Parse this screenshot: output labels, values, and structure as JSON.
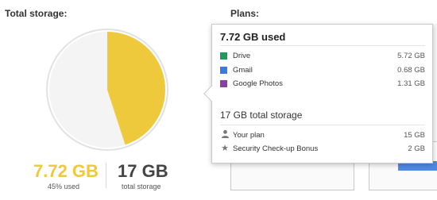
{
  "sections": {
    "total_storage_title": "Total storage:",
    "plans_title": "Plans:"
  },
  "summary": {
    "used_value": "7.72 GB",
    "used_caption": "45% used",
    "total_value": "17 GB",
    "total_caption": "total storage",
    "used_fraction": 0.45
  },
  "colors": {
    "used": "#efc93c",
    "free": "#f4f4f4",
    "drive": "#1a9c5a",
    "gmail": "#3b7be0",
    "photos": "#8a3fa6"
  },
  "popup": {
    "title": "7.72 GB used",
    "services": [
      {
        "label": "Drive",
        "value": "5.72 GB",
        "icon": "drive-swatch"
      },
      {
        "label": "Gmail",
        "value": "0.68 GB",
        "icon": "gmail-swatch"
      },
      {
        "label": "Google Photos",
        "value": "1.31 GB",
        "icon": "photos-swatch"
      }
    ],
    "storage_heading": "17 GB total storage",
    "plan_rows": [
      {
        "label": "Your plan",
        "value": "15 GB",
        "icon": "person-icon"
      },
      {
        "label": "Security Check-up Bonus",
        "value": "2 GB",
        "icon": "star-icon"
      }
    ]
  }
}
